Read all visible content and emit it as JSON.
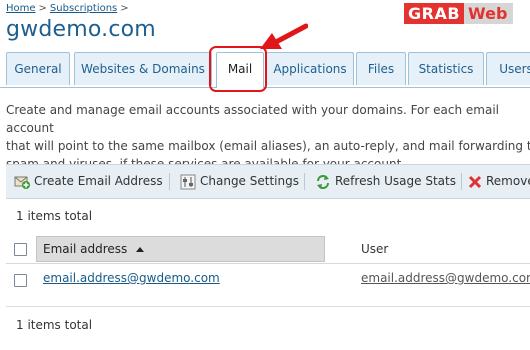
{
  "breadcrumb": {
    "home": "Home",
    "subscriptions": "Subscriptions",
    "separator": ">"
  },
  "page_title": "gwdemo.com",
  "watermark": {
    "part1": "GRAB",
    "part2": "Web"
  },
  "tabs": [
    {
      "label": "General"
    },
    {
      "label": "Websites & Domains"
    },
    {
      "label": "Mail",
      "active": true
    },
    {
      "label": "Applications"
    },
    {
      "label": "Files"
    },
    {
      "label": "Statistics"
    },
    {
      "label": "Users"
    }
  ],
  "description": {
    "line1": "Create and manage email accounts associated with your domains. For each email account",
    "line2": "that will point to the same mailbox (email aliases), an auto-reply, and mail forwarding to",
    "line3": "spam and viruses, if these services are available for your account."
  },
  "toolbar": {
    "create": "Create Email Address",
    "change": "Change Settings",
    "refresh": "Refresh Usage Stats",
    "remove": "Remove"
  },
  "list": {
    "total_top": "1 items total",
    "total_bottom": "1 items total",
    "columns": {
      "email": "Email address",
      "user": "User"
    },
    "rows": [
      {
        "email": "email.address@gwdemo.com",
        "user": "email.address@gwdemo.com"
      }
    ]
  },
  "colors": {
    "accent": "#1f5f8f",
    "highlight": "#e1161b"
  }
}
